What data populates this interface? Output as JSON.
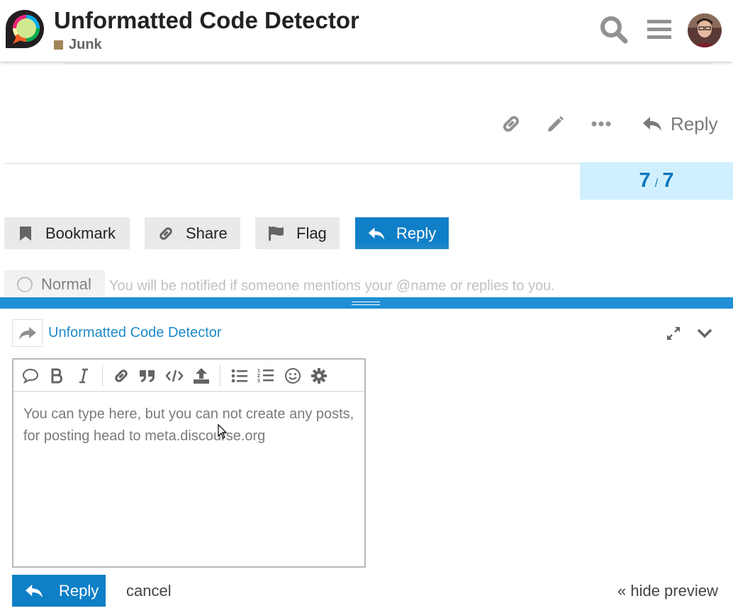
{
  "header": {
    "title": "Unformatted Code Detector",
    "category": "Junk",
    "category_color": "#a1855b"
  },
  "post": {
    "actions": [
      "link-icon",
      "pencil-icon",
      "ellipsis-icon"
    ],
    "reply_label": "Reply"
  },
  "progress": {
    "current": "7",
    "separator": "/",
    "total": "7"
  },
  "footer_buttons": {
    "bookmark": "Bookmark",
    "share": "Share",
    "flag": "Flag",
    "reply": "Reply"
  },
  "notifications": {
    "level": "Normal",
    "description": "You will be notified if someone mentions your @name or replies to you."
  },
  "composer": {
    "reply_to_title": "Unformatted Code Detector",
    "placeholder_text": "You can type here, but you can not create any posts, for posting head to meta.discourse.org",
    "toolbar": [
      "quote-bubble-icon",
      "bold-icon",
      "italic-icon",
      "link-icon",
      "blockquote-icon",
      "code-icon",
      "upload-icon",
      "bullet-list-icon",
      "numbered-list-icon",
      "emoji-icon",
      "gear-icon"
    ],
    "reply_label": "Reply",
    "cancel_label": "cancel",
    "hide_preview_label": "« hide preview"
  },
  "colors": {
    "primary": "#0f7fc7",
    "progress_bg": "#d1f0ff",
    "progress_text": "#0e76bd"
  }
}
